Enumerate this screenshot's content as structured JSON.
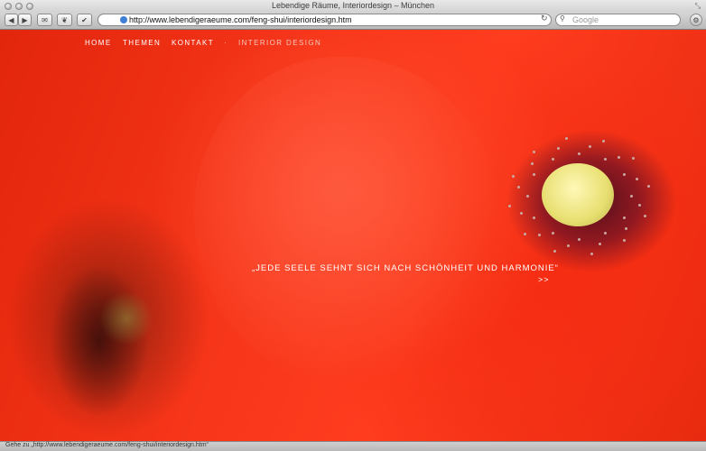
{
  "window": {
    "title": "Lebendige Räume, Interiordesign – München"
  },
  "toolbar": {
    "url": "http://www.lebendigeraeume.com/feng-shui/interiordesign.htm",
    "search_placeholder": "Google",
    "new_tab_label": "+",
    "reload_icon": "↻"
  },
  "site": {
    "nav": [
      "HOME",
      "THEMEN",
      "KONTAKT",
      "·",
      "INTERIOR DESIGN"
    ],
    "quote": "„JEDE SEELE SEHNT SICH NACH SCHÖNHEIT UND HARMONIE“",
    "more": ">>"
  },
  "status": {
    "text": "Gehe zu „http://www.lebendigeraeume.com/feng-shui/interiordesign.htm“"
  },
  "colors": {
    "accent": "#f2331a",
    "nav_active": "#f6c9bd"
  }
}
